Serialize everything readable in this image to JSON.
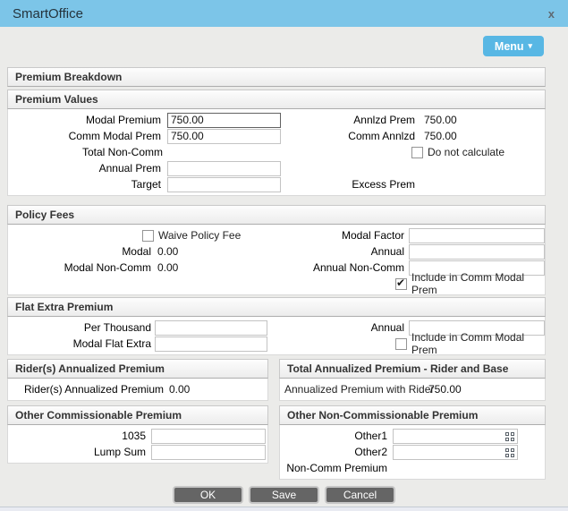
{
  "colors": {
    "titlebar_bg": "#7cc5e8",
    "menu_btn_bg": "#58b7e4",
    "body_bg": "#ebebe9",
    "btn_bg": "#656565"
  },
  "window": {
    "title": "SmartOffice",
    "close": "x"
  },
  "menu": {
    "label": "Menu",
    "caret": "▾"
  },
  "sections": {
    "premium_breakdown": {
      "title": "Premium Breakdown"
    },
    "premium_values": {
      "title": "Premium Values",
      "modal_premium": {
        "label": "Modal Premium",
        "value": "750.00"
      },
      "comm_modal_prem": {
        "label": "Comm Modal Prem",
        "value": "750.00"
      },
      "total_non_comm": {
        "label": "Total Non-Comm",
        "value": ""
      },
      "annual_prem": {
        "label": "Annual Prem",
        "value": ""
      },
      "target": {
        "label": "Target",
        "value": ""
      },
      "annlzd_prem": {
        "label": "Annlzd Prem",
        "value": "750.00"
      },
      "comm_annlzd": {
        "label": "Comm Annlzd",
        "value": "750.00"
      },
      "do_not_calculate": {
        "label": "Do not calculate",
        "checked": false
      },
      "excess_prem": {
        "label": "Excess Prem",
        "value": ""
      }
    },
    "policy_fees": {
      "title": "Policy Fees",
      "waive_policy_fee": {
        "label": "Waive Policy Fee",
        "checked": false
      },
      "modal": {
        "label": "Modal",
        "value": "0.00"
      },
      "modal_non_comm": {
        "label": "Modal Non-Comm",
        "value": "0.00"
      },
      "modal_factor": {
        "label": "Modal Factor",
        "value": ""
      },
      "annual": {
        "label": "Annual",
        "value": ""
      },
      "annual_non_comm": {
        "label": "Annual Non-Comm",
        "value": ""
      },
      "include_in_comm_modal_prem": {
        "label": "Include in Comm Modal Prem",
        "checked": true
      }
    },
    "flat_extra_premium": {
      "title": "Flat Extra Premium",
      "per_thousand": {
        "label": "Per Thousand",
        "value": ""
      },
      "modal_flat_extra": {
        "label": "Modal Flat Extra",
        "value": ""
      },
      "annual": {
        "label": "Annual",
        "value": ""
      },
      "include_in_comm_modal_prem": {
        "label": "Include in Comm Modal Prem",
        "checked": false
      }
    },
    "riders_annualized": {
      "title": "Rider(s) Annualized Premium",
      "riders_annualized_premium": {
        "label": "Rider(s) Annualized Premium",
        "value": "0.00"
      }
    },
    "total_annualized": {
      "title": "Total Annualized Premium - Rider and Base",
      "annualized_premium_with_rider": {
        "label": "Annualized Premium with Rider",
        "value": "750.00"
      }
    },
    "other_commissionable": {
      "title": "Other Commissionable Premium",
      "f1035": {
        "label": "1035",
        "value": ""
      },
      "lump_sum": {
        "label": "Lump Sum",
        "value": ""
      }
    },
    "other_non_commissionable": {
      "title": "Other Non-Commissionable Premium",
      "other1": {
        "label": "Other1",
        "value": ""
      },
      "other2": {
        "label": "Other2",
        "value": ""
      },
      "non_comm_premium": {
        "label": "Non-Comm Premium",
        "value": ""
      }
    }
  },
  "footer": {
    "ok": "OK",
    "save": "Save",
    "cancel": "Cancel"
  }
}
